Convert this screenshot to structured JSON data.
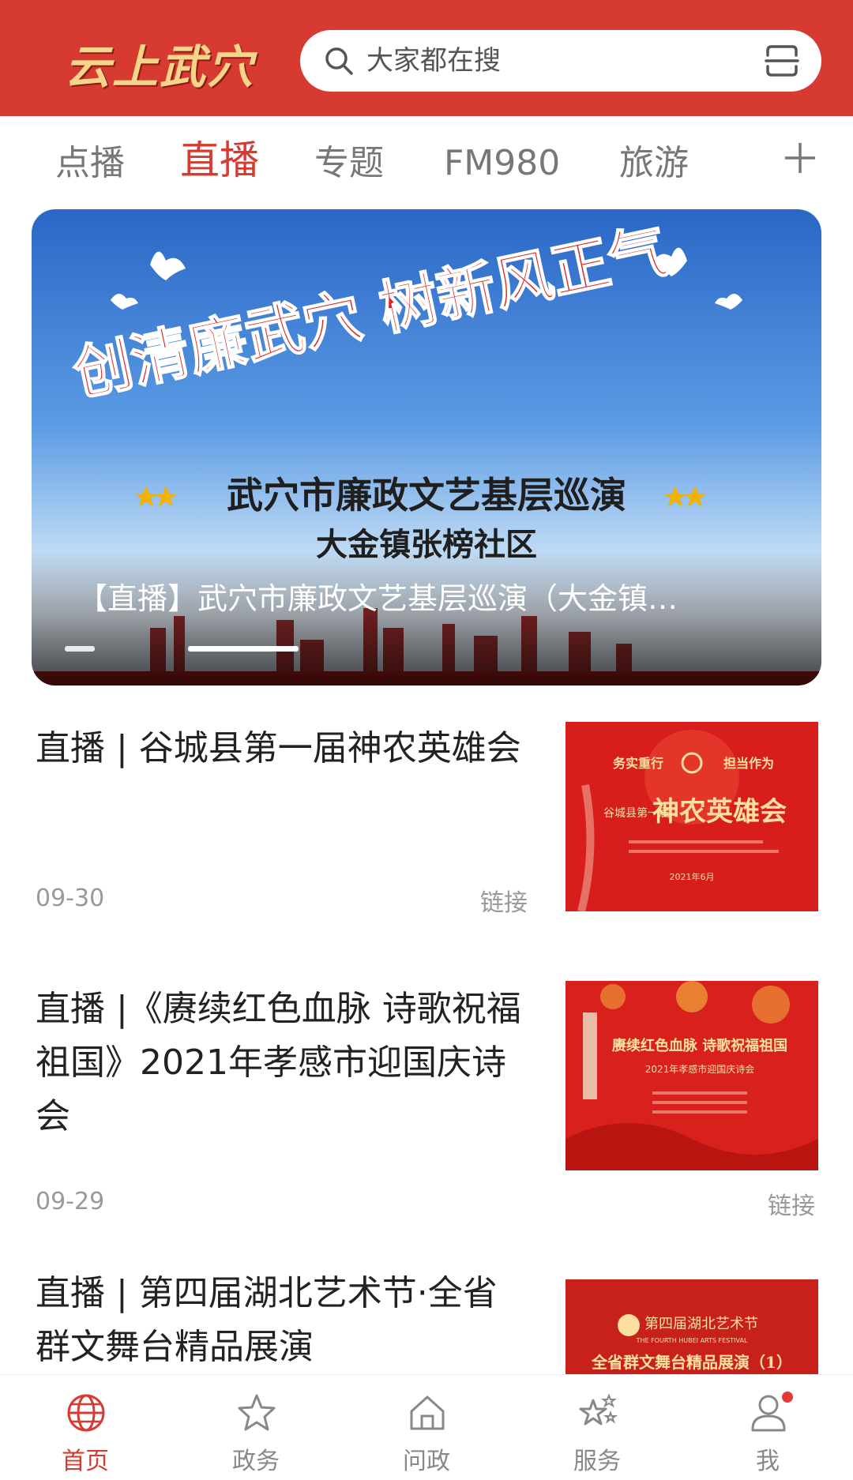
{
  "header": {
    "logo_text": "云上武穴",
    "search_placeholder": "大家都在搜",
    "brand_color": "#d63a30"
  },
  "tabs": [
    {
      "label": "点播",
      "active": false
    },
    {
      "label": "直播",
      "active": true
    },
    {
      "label": "专题",
      "active": false
    },
    {
      "label": "FM980",
      "active": false
    },
    {
      "label": "旅游",
      "active": false
    }
  ],
  "tab_add_icon": "plus-icon",
  "banner": {
    "headline": "创清廉武穴 树新风正气",
    "subtitle": "武穴市廉政文艺基层巡演",
    "partial_line": "大金镇张榜社区",
    "caption": "【直播】武穴市廉政文艺基层巡演（大金镇…",
    "page_count": 2,
    "active_page": 2
  },
  "news": [
    {
      "title": "直播 | 谷城县第一届神农英雄会",
      "date": "09-30",
      "tag": "链接",
      "thumb": {
        "top_left": "务实重行",
        "top_right": "担当作为",
        "small_left": "谷城县第一届",
        "main": "神农英雄会",
        "footer": "2021年6月"
      }
    },
    {
      "title": "直播 |《赓续红色血脉 诗歌祝福祖国》2021年孝感市迎国庆诗会",
      "date": "09-29",
      "tag": "链接",
      "thumb": {
        "main": "赓续红色血脉 诗歌祝福祖国",
        "sub": "2021年孝感市迎国庆诗会"
      }
    },
    {
      "title": "直播 | 第四届湖北艺术节·全省群文舞台精品展演",
      "thumb": {
        "top": "第四届湖北艺术节",
        "top_en": "THE FOURTH HUBEI ARTS FESTIVAL",
        "main": "全省群文舞台精品展演（1）"
      }
    }
  ],
  "bottom_nav": [
    {
      "label": "首页",
      "icon": "globe-icon",
      "active": true
    },
    {
      "label": "政务",
      "icon": "star-icon",
      "active": false
    },
    {
      "label": "问政",
      "icon": "home-icon",
      "active": false
    },
    {
      "label": "服务",
      "icon": "stars-icon",
      "active": false
    },
    {
      "label": "我",
      "icon": "user-icon",
      "active": false,
      "badge": true
    }
  ]
}
